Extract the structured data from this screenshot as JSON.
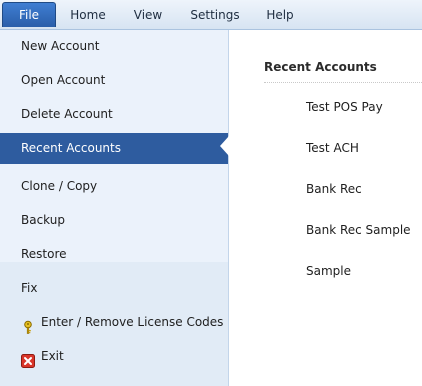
{
  "menubar": {
    "file_label": "File",
    "tabs": [
      "Home",
      "View",
      "Settings",
      "Help"
    ]
  },
  "nav": {
    "items": [
      {
        "label": "New Account"
      },
      {
        "label": "Open Account"
      },
      {
        "label": "Delete Account"
      },
      {
        "label": "Recent Accounts",
        "selected": true
      },
      {
        "label": "Clone / Copy"
      },
      {
        "label": "Backup"
      },
      {
        "label": "Restore"
      },
      {
        "label": "Fix"
      },
      {
        "label": "Enter / Remove License Codes",
        "icon": "key-icon"
      },
      {
        "label": "Exit",
        "icon": "close-icon"
      }
    ]
  },
  "recent": {
    "header": "Recent Accounts",
    "items": [
      "Test POS Pay",
      "Test ACH",
      "Bank Rec",
      "Bank Rec Sample",
      "Sample"
    ]
  },
  "colors": {
    "selected_bg": "#2e5c9f",
    "file_tab_bg": "#2a5ea9",
    "nav_bg": "#ebf2fb"
  }
}
